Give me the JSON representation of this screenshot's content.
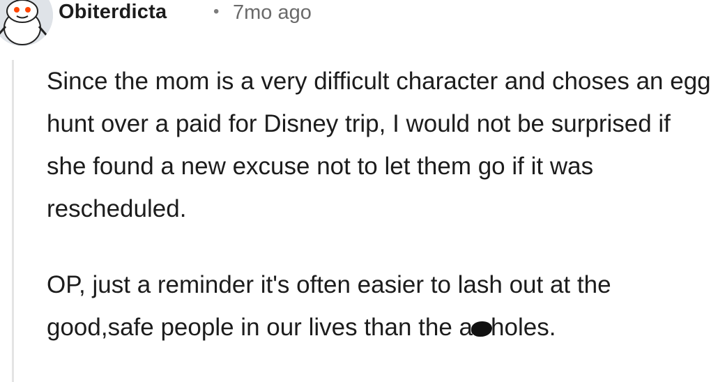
{
  "comment": {
    "username": "Obiterdicta",
    "separator": "•",
    "timestamp": "7mo ago",
    "avatar_icon": "reddit-snoo-avatar-icon",
    "paragraphs": [
      "Since the mom is a very difficult character and choses an egg hunt over a paid for Disney trip, I would not be surprised if she found a new excuse not to let them go if it was rescheduled.",
      "OP, just a reminder it's often easier to lash out at the good,safe people in our lives than the"
    ],
    "censored_word": {
      "prefix": "a",
      "suffix": "holes."
    }
  }
}
